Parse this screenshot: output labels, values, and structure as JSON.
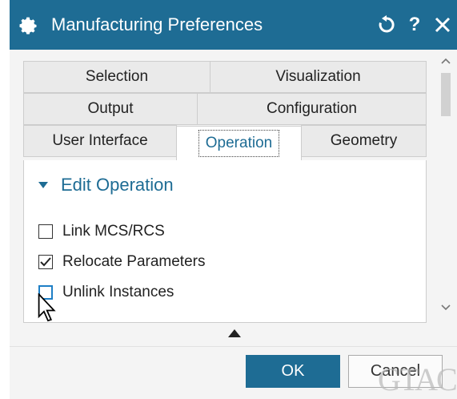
{
  "window": {
    "title": "Manufacturing Preferences",
    "reset_icon": "reset-icon",
    "help_label": "?",
    "close_icon": "close-icon",
    "accent_color": "#1e6c94"
  },
  "tabs": [
    {
      "label": "Selection",
      "active": false
    },
    {
      "label": "Visualization",
      "active": false
    },
    {
      "label": "Output",
      "active": false
    },
    {
      "label": "Configuration",
      "active": false
    },
    {
      "label": "User Interface",
      "active": false
    },
    {
      "label": "Operation",
      "active": true
    },
    {
      "label": "Geometry",
      "active": false
    }
  ],
  "section": {
    "title": "Edit Operation",
    "expanded": true
  },
  "options": [
    {
      "label": "Link MCS/RCS",
      "checked": false
    },
    {
      "label": "Relocate Parameters",
      "checked": true
    },
    {
      "label": "Unlink Instances",
      "checked": false
    }
  ],
  "buttons": {
    "ok": "OK",
    "cancel": "Cancel"
  },
  "watermark": "GTAC"
}
